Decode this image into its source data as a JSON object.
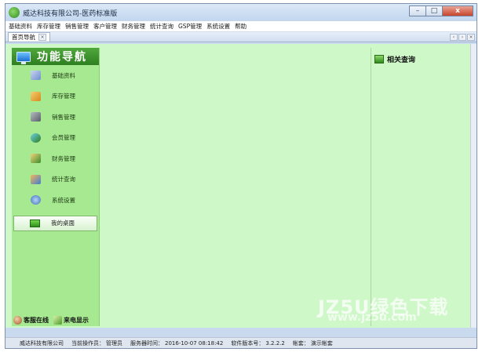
{
  "window": {
    "title": "威达科技有限公司-医药标准版",
    "controls": {
      "minimize": "–",
      "maximize": "□",
      "close": "x"
    }
  },
  "menu": [
    "基础资料",
    "库存管理",
    "销售管理",
    "客户管理",
    "财务管理",
    "统计查询",
    "GSP管理",
    "系统设置",
    "帮助"
  ],
  "tabs": [
    {
      "label": "首页导航"
    }
  ],
  "nav": {
    "title": "功能导航",
    "items": [
      {
        "label": "基础资料",
        "icon": "pencil-icon",
        "color": "#9ab2e0"
      },
      {
        "label": "库存管理",
        "icon": "cart-icon",
        "color": "#e5a63a"
      },
      {
        "label": "销售管理",
        "icon": "cash-register-icon",
        "color": "#7a7f86"
      },
      {
        "label": "会员管理",
        "icon": "members-icon",
        "color": "#3c8a2a"
      },
      {
        "label": "财务管理",
        "icon": "finance-icon",
        "color": "#c88a2a"
      },
      {
        "label": "统计查询",
        "icon": "statistics-icon",
        "color": "#e07a2e"
      },
      {
        "label": "系统设置",
        "icon": "gears-icon",
        "color": "#4a7fc9"
      }
    ],
    "desk": {
      "label": "我的桌面",
      "icon": "desktop-icon"
    },
    "bottom": [
      {
        "label": "客服在线",
        "icon": "service-icon",
        "color": "#b7663a"
      },
      {
        "label": "来电显示",
        "icon": "caller-id-icon",
        "color": "#6fb64a"
      }
    ]
  },
  "right_panel": {
    "title": "相关查询",
    "icon": "chart-icon"
  },
  "watermark": {
    "main": "JZ5U绿色下载",
    "sub": "www.jz5u.com"
  },
  "status": {
    "company": "威达科技有限公司",
    "operator_label": "当前操作员：",
    "operator": "管理员",
    "server_time_label": "服务器时间：",
    "server_time": "2016-10-07 08:18:42",
    "version_label": "软件版本号：",
    "version": "3.2.2.2",
    "account_label": "帐套：",
    "account": "演示帐套"
  },
  "colors": {
    "content_bg": "#cff8c9",
    "nav_bg": "#a6e990",
    "nav_header": "#3e9530"
  }
}
